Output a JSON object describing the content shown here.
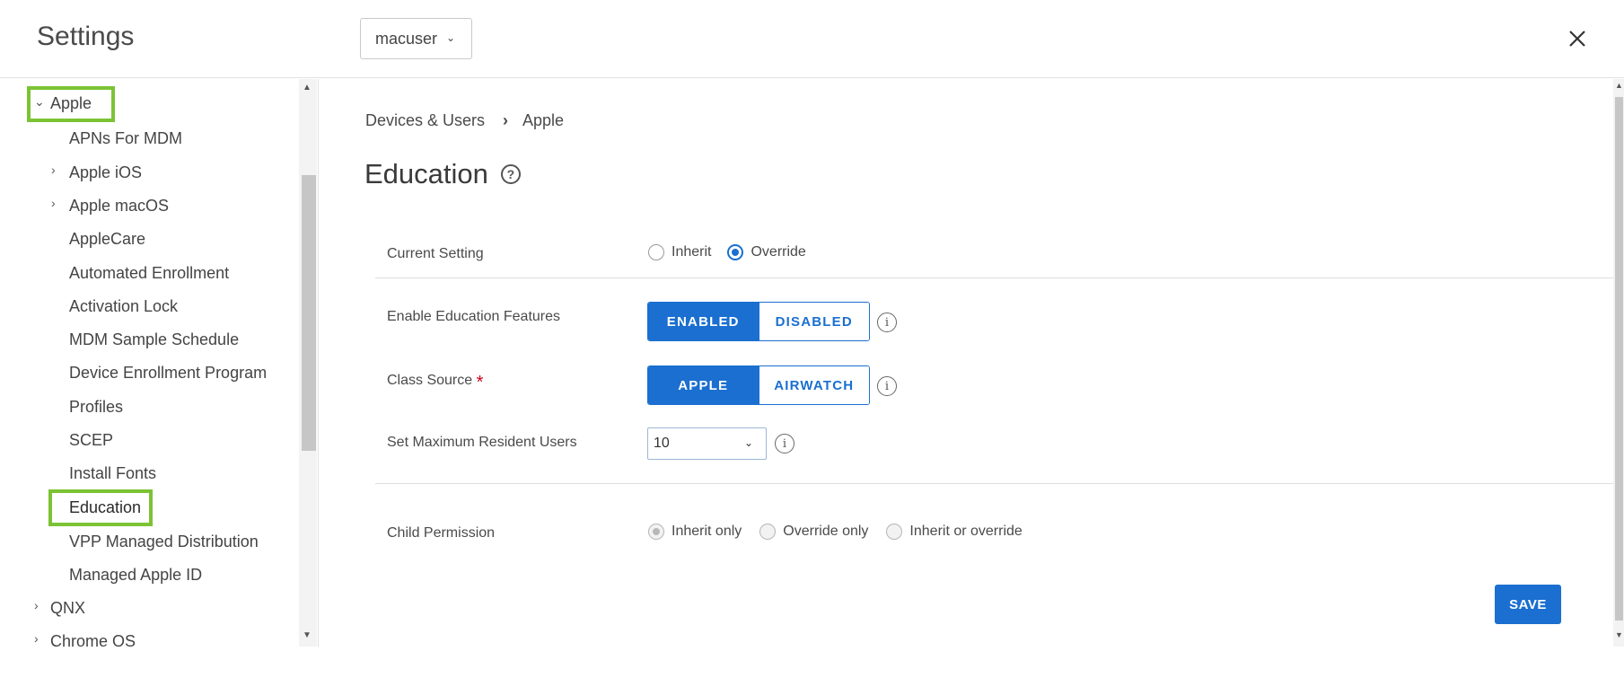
{
  "header": {
    "title": "Settings",
    "org_selector": "macuser",
    "close_icon": "close-icon"
  },
  "sidebar": {
    "items": [
      {
        "label": "Apple",
        "expanded": true,
        "highlighted": true
      },
      {
        "label": "APNs For MDM"
      },
      {
        "label": "Apple iOS",
        "expandable": true
      },
      {
        "label": "Apple macOS",
        "expandable": true
      },
      {
        "label": "AppleCare"
      },
      {
        "label": "Automated Enrollment"
      },
      {
        "label": "Activation Lock"
      },
      {
        "label": "MDM Sample Schedule"
      },
      {
        "label": "Device Enrollment Program"
      },
      {
        "label": "Profiles"
      },
      {
        "label": "SCEP"
      },
      {
        "label": "Install Fonts"
      },
      {
        "label": "Education",
        "selected": true,
        "highlighted": true
      },
      {
        "label": "VPP Managed Distribution"
      },
      {
        "label": "Managed Apple ID"
      },
      {
        "label": "QNX",
        "expandable": true
      },
      {
        "label": "Chrome OS",
        "expandable": true
      }
    ]
  },
  "breadcrumb": {
    "parent": "Devices & Users",
    "current": "Apple"
  },
  "page": {
    "title": "Education"
  },
  "form": {
    "current_setting": {
      "label": "Current Setting",
      "options": [
        "Inherit",
        "Override"
      ],
      "selected": "Override"
    },
    "education_features": {
      "label": "Enable Education Features",
      "options": [
        "ENABLED",
        "DISABLED"
      ],
      "selected": "ENABLED"
    },
    "class_source": {
      "label": "Class Source",
      "required_mark": "*",
      "options": [
        "APPLE",
        "AIRWATCH"
      ],
      "selected": "APPLE"
    },
    "max_resident_users": {
      "label": "Set Maximum Resident Users",
      "value": "10"
    },
    "child_permission": {
      "label": "Child Permission",
      "options": [
        "Inherit only",
        "Override only",
        "Inherit or override"
      ],
      "selected": "Inherit only"
    },
    "save_label": "SAVE"
  },
  "colors": {
    "accent": "#1a6fd0",
    "highlight": "#7cc334",
    "required": "#d0021b"
  }
}
